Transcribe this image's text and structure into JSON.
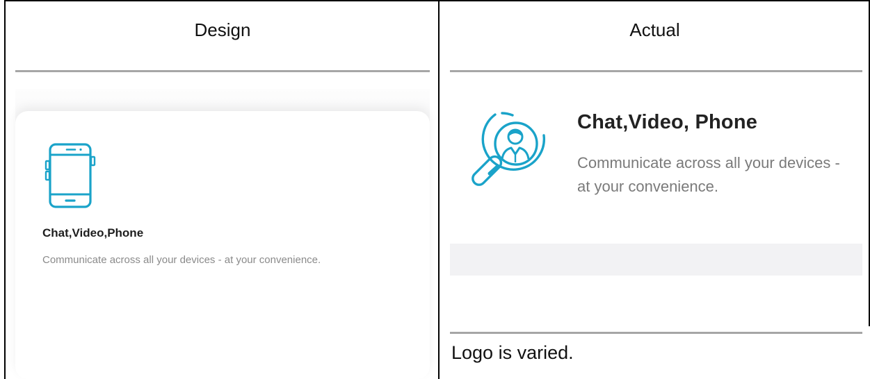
{
  "table": {
    "col_design_header": "Design",
    "col_actual_header": "Actual",
    "design": {
      "icon": "smartphone-icon",
      "title": "Chat,Video,Phone",
      "description": "Communicate across all your devices - at your convenience."
    },
    "actual": {
      "icon": "magnifier-user-icon",
      "title": "Chat,Video, Phone",
      "description": "Communicate across all your devices - at your convenience."
    },
    "note": "Logo is varied."
  },
  "colors": {
    "accent": "#1aa3c9",
    "rule": "#a6a6a6"
  }
}
